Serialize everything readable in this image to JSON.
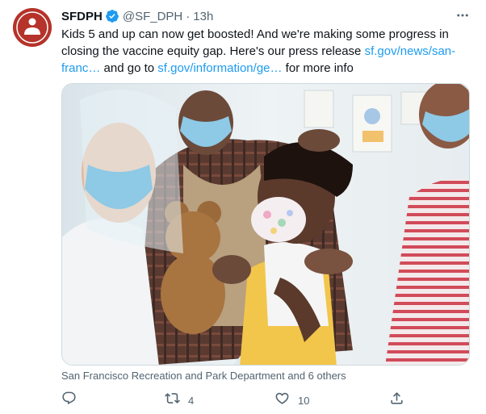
{
  "tweet": {
    "author": {
      "display_name": "SFDPH",
      "handle": "@SF_DPH",
      "verified": true
    },
    "separator": "·",
    "time": "13h",
    "text": {
      "line1": "Kids 5 and up can now get boosted! And we're making some progress in",
      "line2_prefix": "closing the vaccine equity gap. Here's our press release ",
      "link1_part1": "sf.gov/news/san-",
      "link1_part2": "franc…",
      "line3_middle": " and go to ",
      "link2": "sf.gov/information/ge…",
      "line3_suffix": " for more info"
    },
    "media": {
      "alt": "Child wearing a polka-dot mask receiving a vaccine from a health worker in a face shield while a parent holds her hand"
    },
    "tagged": "San Francisco Recreation and Park Department and 6 others",
    "actions": {
      "reply_icon": "reply-icon",
      "retweet_icon": "retweet-icon",
      "retweet_count": "4",
      "like_icon": "heart-icon",
      "like_count": "10",
      "share_icon": "share-icon"
    }
  },
  "colors": {
    "link": "#1d9bf0",
    "secondary_text": "#536471",
    "verified": "#1d9bf0",
    "avatar_bg": "#b5332a"
  }
}
